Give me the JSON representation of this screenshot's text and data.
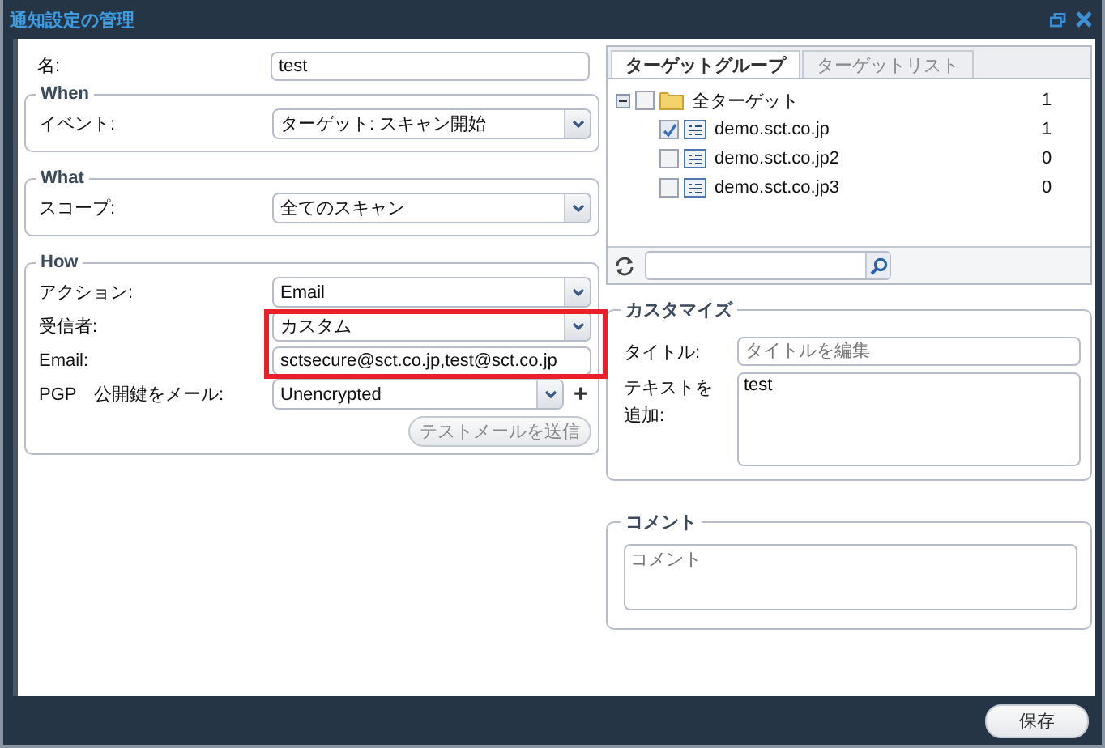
{
  "window": {
    "title": "通知設定の管理"
  },
  "name_field": {
    "label": "名:",
    "value": "test"
  },
  "when": {
    "legend": "When",
    "label": "イベント:",
    "value": "ターゲット: スキャン開始"
  },
  "what": {
    "legend": "What",
    "label": "スコープ:",
    "value": "全てのスキャン"
  },
  "how": {
    "legend": "How",
    "action": {
      "label": "アクション:",
      "value": "Email"
    },
    "recipient": {
      "label": "受信者:",
      "value": "カスタム"
    },
    "email": {
      "label": "Email:",
      "value": "sctsecure@sct.co.jp,test@sct.co.jp"
    },
    "pgp": {
      "label": "PGP　公開鍵をメール:",
      "value": "Unencrypted",
      "add": "+"
    },
    "test_button": "テストメールを送信"
  },
  "tabs": [
    {
      "label": "ターゲットグループ",
      "selected": true
    },
    {
      "label": "ターゲットリスト",
      "selected": false
    }
  ],
  "tree": [
    {
      "label": "全ターゲット",
      "count": "1",
      "checked": false,
      "expanded": true,
      "children": [
        {
          "label": "demo.sct.co.jp",
          "count": "1",
          "checked": true
        },
        {
          "label": "demo.sct.co.jp2",
          "count": "0",
          "checked": false
        },
        {
          "label": "demo.sct.co.jp3",
          "count": "0",
          "checked": false
        }
      ]
    }
  ],
  "customize": {
    "legend": "カスタマイズ",
    "title_label": "タイトル:",
    "title_placeholder": "タイトルを編集",
    "text_label": "テキストを追加:",
    "text_value": "test"
  },
  "comment": {
    "legend": "コメント",
    "placeholder": "コメント"
  },
  "buttons": [
    "保存"
  ]
}
